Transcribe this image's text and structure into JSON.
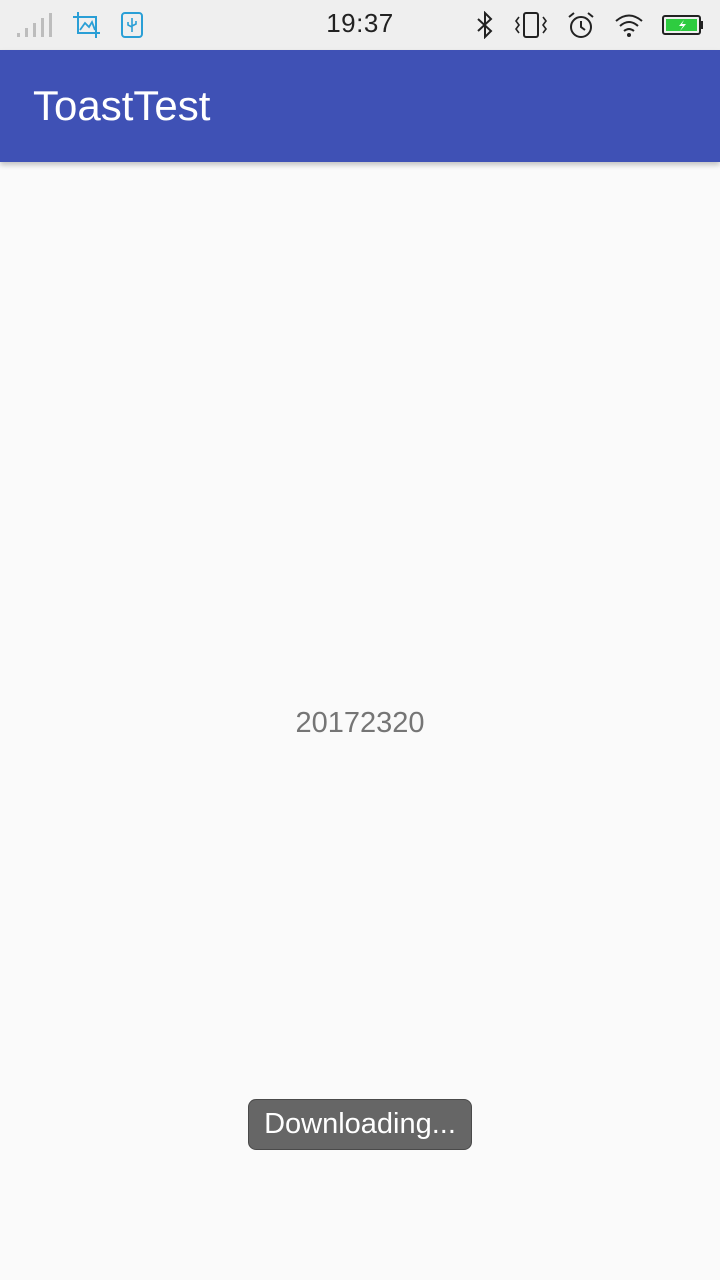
{
  "status_bar": {
    "time": "19:37",
    "left_icons": [
      "signal-icon",
      "screenshot-icon",
      "usb-icon"
    ],
    "right_icons": [
      "bluetooth-icon",
      "vibrate-icon",
      "alarm-icon",
      "wifi-icon",
      "battery-icon"
    ]
  },
  "app_bar": {
    "title": "ToastTest",
    "color": "#3f51b5"
  },
  "main": {
    "center_text": "20172320"
  },
  "toast": {
    "message": "Downloading..."
  },
  "colors": {
    "accent": "#3f51b5",
    "status_icon_teal": "#2a9fd6",
    "battery_green": "#2ecc40"
  }
}
